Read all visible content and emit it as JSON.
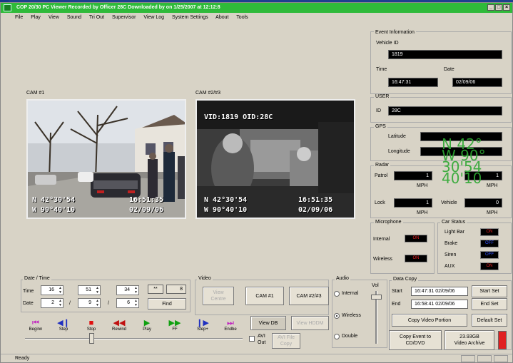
{
  "window": {
    "title": "COP 20/30 PC Viewer        Recorded by Officer 28C   Downloaded by  on 1/25/2007 at 12:12:8"
  },
  "menu": [
    "File",
    "Play",
    "View",
    "Sound",
    "Tri Out",
    "Supervisor",
    "View Log",
    "System Settings",
    "About",
    "Tools"
  ],
  "cameras": {
    "cam1": {
      "label": "CAM #1",
      "overlay_lat": "N 42°30'54",
      "overlay_lon": "W 90°40'10",
      "overlay_time": "16:51:35",
      "overlay_date": "02/09/06"
    },
    "cam2": {
      "label": "CAM #2/#3",
      "overlay_top": "VID:1819  OID:28C",
      "overlay_lat": "N 42°30'54",
      "overlay_lon": "W 90°40'10",
      "overlay_time": "16:51:35",
      "overlay_date": "02/09/06"
    }
  },
  "event_info": {
    "title": "Event Information",
    "vehicle_id_label": "Vehicle ID",
    "vehicle_id": "1819",
    "time_label": "Time",
    "time": "16:47:31",
    "date_label": "Date",
    "date": "02/09/06"
  },
  "user": {
    "title": "USER",
    "id_label": "ID",
    "id": "28C"
  },
  "gps": {
    "title": "GPS",
    "latitude_label": "Latitude",
    "longitude_label": "Longitude",
    "big_text": "N 42°\nW 90°\n30'54\n40'10"
  },
  "radar": {
    "title": "Radar",
    "patrol_label": "Patrol",
    "patrol_value": "1",
    "patrol_unit": "MPH",
    "right_value": "1",
    "right_unit": "MPH",
    "lock_label": "Lock",
    "lock_value": "1",
    "lock_unit": "MPH",
    "vehicle_label": "Vehicle",
    "vehicle_value": "0",
    "vehicle_unit": "MPH"
  },
  "microphone": {
    "title": "Microphone",
    "internal_label": "Internal",
    "internal_state": "ON",
    "wireless_label": "Wireless",
    "wireless_state": "ON"
  },
  "car_status": {
    "title": "Car Status",
    "items": [
      {
        "label": "Light Bar",
        "state": "ON",
        "color": "#e02020"
      },
      {
        "label": "Brake",
        "state": "OFF",
        "color": "#3050ff"
      },
      {
        "label": "Siren",
        "state": "OFF",
        "color": "#3050ff"
      },
      {
        "label": "AUX",
        "state": "ON",
        "color": "#e02020"
      }
    ]
  },
  "date_time": {
    "title": "Date / Time",
    "time_label": "Time",
    "hour": "16",
    "minute": "51",
    "second": "34",
    "date_label": "Date",
    "month": "2",
    "day": "9",
    "year": "6",
    "sep": "/",
    "counter_a": "**",
    "counter_b": "8",
    "find_label": "Find"
  },
  "playback": {
    "buttons": [
      {
        "name": "begin",
        "glyph": "⏮",
        "label": "Beginn",
        "color": "#c020c0"
      },
      {
        "name": "step",
        "glyph": "◀❙",
        "label": "Step",
        "color": "#2030c0"
      },
      {
        "name": "stop",
        "glyph": "■",
        "label": "Stop",
        "color": "#e01010"
      },
      {
        "name": "rewind",
        "glyph": "◀◀",
        "label": "Rewind",
        "color": "#c01010"
      },
      {
        "name": "play",
        "glyph": "▶",
        "label": "Play",
        "color": "#10a010"
      },
      {
        "name": "ff",
        "glyph": "▶▶",
        "label": "FF",
        "color": "#10a010"
      },
      {
        "name": "step-fwd",
        "glyph": "❙▶",
        "label": "Step+",
        "color": "#2030c0"
      },
      {
        "name": "end",
        "glyph": "⏭",
        "label": "Endbe",
        "color": "#c020c0"
      }
    ]
  },
  "video": {
    "title": "Video",
    "view_centre_label": "View\nCentre",
    "cam1_label": "CAM #1",
    "cam23_label": "CAM #2/#3",
    "view_db_label": "View DB",
    "view_hddm_label": "View HDDM",
    "avi_out_label": "AVI\nOut",
    "avi_file_label": "AVI File\nCopy"
  },
  "audio": {
    "title": "Audio",
    "vol_label": "Vol",
    "internal_label": "Internal",
    "wireless_label": "Wireless",
    "double_label": "Double"
  },
  "data_copy": {
    "title": "Data Copy",
    "start_label": "Start",
    "start_value": "16:47:31 02/09/06",
    "end_label": "End",
    "end_value": "16:58:41 02/09/06",
    "start_set_label": "Start Set",
    "end_set_label": "End Set",
    "copy_video_label": "Copy Video Portion",
    "default_set_label": "Default Set",
    "copy_event_label": "Copy Event to\nCD/DVD",
    "archive_label": "23.93GB\nVideo Archive"
  },
  "status": {
    "text": "Ready"
  },
  "colors": {
    "title_green": "#2fba3a",
    "window_gray": "#d8d3c6",
    "desktop_blue": "#1d3f8f"
  }
}
